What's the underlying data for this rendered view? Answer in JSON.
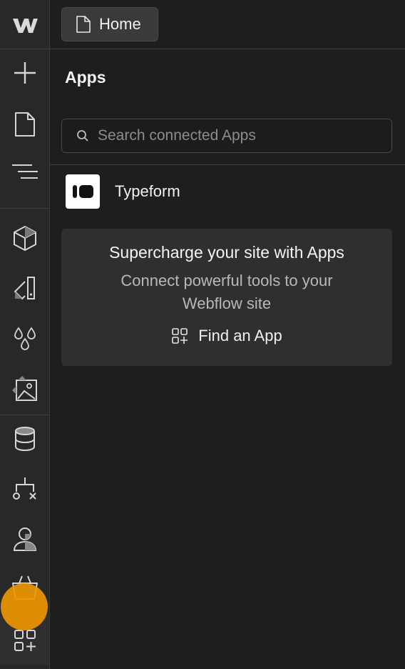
{
  "topbar": {
    "page_label": "Home",
    "page_icon": "page-icon"
  },
  "rail": {
    "logo": "webflow-logo",
    "items": [
      {
        "name": "add-elements",
        "icon": "plus-icon"
      },
      {
        "name": "pages",
        "icon": "page-icon"
      },
      {
        "name": "navigator",
        "icon": "navigator-icon"
      },
      {
        "name": "components",
        "icon": "cube-icon"
      },
      {
        "name": "style-selectors",
        "icon": "style-icon"
      },
      {
        "name": "variables",
        "icon": "drops-icon"
      },
      {
        "name": "assets",
        "icon": "image-icon"
      },
      {
        "name": "cms",
        "icon": "database-icon"
      },
      {
        "name": "logic",
        "icon": "flow-icon"
      },
      {
        "name": "users",
        "icon": "user-icon"
      },
      {
        "name": "ecommerce",
        "icon": "basket-icon"
      },
      {
        "name": "apps",
        "icon": "apps-icon",
        "active": true
      }
    ]
  },
  "panel": {
    "title": "Apps",
    "search": {
      "placeholder": "Search connected Apps",
      "value": ""
    },
    "apps": [
      {
        "name": "Typeform",
        "icon": "typeform-logo"
      }
    ],
    "promo": {
      "title": "Supercharge your site with Apps",
      "subtitle": "Connect powerful tools to your Webflow site",
      "link_label": "Find an App",
      "link_icon": "apps-add-icon"
    }
  },
  "colors": {
    "accent_cursor": "#ec9600",
    "background": "#1e1e1e",
    "rail": "#282828"
  }
}
